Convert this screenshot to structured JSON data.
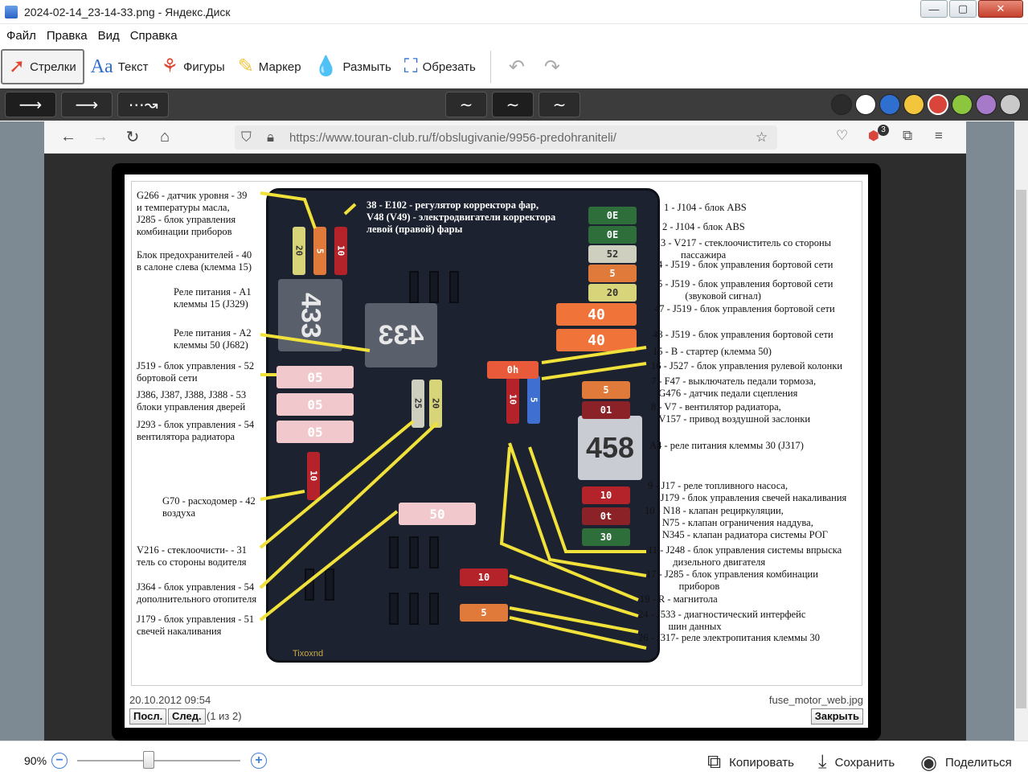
{
  "window": {
    "title": "2024-02-14_23-14-33.png - Яндекс.Диск",
    "minimize": "—",
    "maximize": "▢",
    "close": "✕"
  },
  "menu": [
    "Файл",
    "Правка",
    "Вид",
    "Справка"
  ],
  "toolbar": {
    "arrows": "Стрелки",
    "text": "Текст",
    "shapes": "Фигуры",
    "marker": "Маркер",
    "blur": "Размыть",
    "crop": "Обрезать"
  },
  "palette": [
    "#2b2b2b",
    "#ffffff",
    "#2f6fd0",
    "#f2c53d",
    "#d9453a",
    "#8cc63f",
    "#a77ac9",
    "#c9c9c9"
  ],
  "browser": {
    "url": "https://www.touran-club.ru/f/obslugivanie/9956-predohraniteli/",
    "abp_count": "3"
  },
  "lightbox": {
    "date": "20.10.2012 09:54",
    "filename": "fuse_motor_web.jpg",
    "prev": "Посл.",
    "next": "След.",
    "counter": "(1 из 2)",
    "close": "Закрыть"
  },
  "photo": {
    "top_label": "38 - E102 - регулятор корректора фар,\nV48 (V49) - электродвигатели корректора\nлевой (правой) фары",
    "left_labels": [
      "G266 - датчик уровня - 39\nи температуры масла,\nJ285 - блок управления\nкомбинации приборов",
      "Блок предохранителей - 40\nв салоне слева (клемма 15)",
      "Реле питания - A1\nклеммы 15 (J329)",
      "Реле питания - A2\nклеммы 50 (J682)",
      "J519 - блок управления - 52\nбортовой сети",
      "J386, J387, J388, J388 - 53\nблоки управления дверей",
      "J293 - блок управления - 54\nвентилятора радиатора",
      "G70 - расходомер - 42\nвоздуха",
      "V216 - стеклоочисти- - 31\nтель со стороны водителя",
      "J364 - блок управления - 54\nдополнительного отопителя",
      "J179 - блок управления - 51\nсвечей накаливания"
    ],
    "right_labels": [
      "1 - J104 - блок ABS",
      "2 - J104 - блок ABS",
      "3 - V217 - стеклоочиститель со стороны\n        пассажира",
      "4 - J519 - блок управления бортовой сети",
      "5 - J519 - блок управления бортовой сети\n           (звуковой сигнал)",
      "47 - J519 - блок управления бортовой сети",
      "48 - J519 - блок управления бортовой сети",
      "15 - B - стартер (клемма 50)",
      "16 - J527 - блок управления рулевой колонки",
      "7 - F47 - выключатель педали тормоза,\n   G476 - датчик педали сцепления",
      "8 - V7 - вентилятор радиатора,\n   V157 - привод воздушной заслонки",
      "A4 - реле питания клеммы 30 (J317)",
      "9 - J17 - реле топливного насоса,\n     J179 - блок управления свечей накаливания",
      "10 - N18 - клапан рециркуляции,\n       N75 - клапан ограничения наддува,\n       N345 - клапан радиатора системы РОГ",
      "11 - J248 - блок управления системы впрыска\n          дизельного двигателя",
      "17 - J285 - блок управления комбинации\n             приборов",
      "19 - R - магнитола",
      "24 - J533 - диагностический интерфейс\n            шин данных",
      "26 - J317- реле электропитания клеммы 30"
    ],
    "relays": [
      "433",
      "433",
      "458"
    ],
    "fuses_h": [
      "0E",
      "0E",
      "52",
      "5",
      "20",
      "40",
      "40",
      "0h",
      "5",
      "01",
      "05",
      "05",
      "05",
      "50",
      "10",
      "0t",
      "30",
      "10",
      "5"
    ],
    "fuses_v": [
      "20",
      "5",
      "10",
      "25",
      "20",
      "10",
      "5",
      "10"
    ],
    "watermark": "Tixoxnd"
  },
  "status": {
    "zoom": "90%",
    "copy": "Копировать",
    "save": "Сохранить",
    "share": "Поделиться"
  }
}
